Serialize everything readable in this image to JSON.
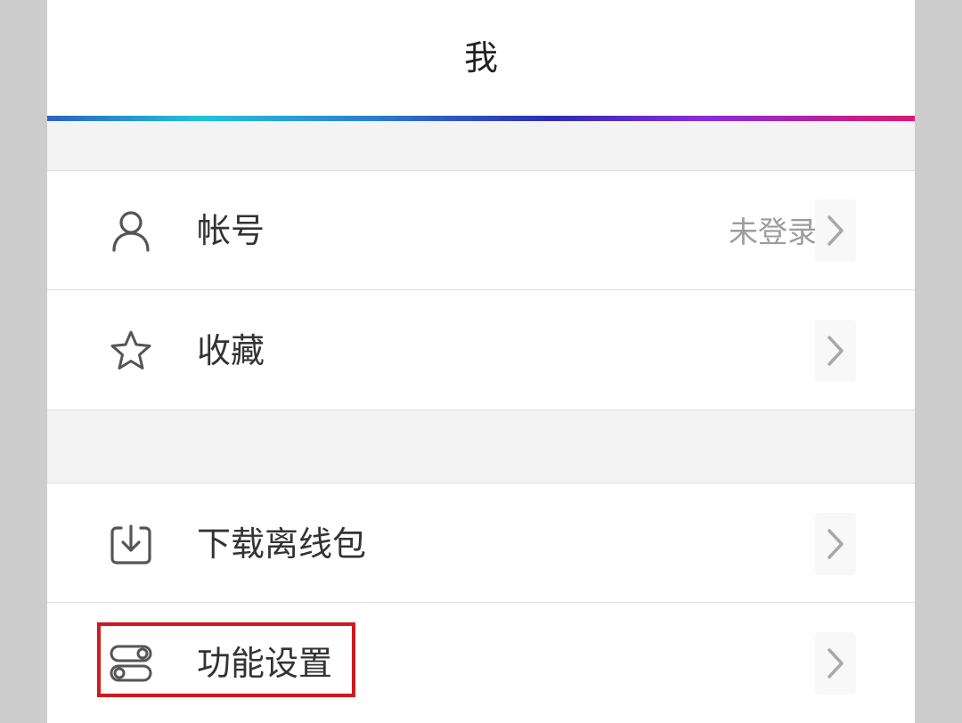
{
  "header": {
    "title": "我"
  },
  "menu": {
    "account": {
      "label": "帐号",
      "value": "未登录",
      "icon": "user-icon"
    },
    "favorites": {
      "label": "收藏",
      "icon": "star-icon"
    },
    "offline": {
      "label": "下载离线包",
      "icon": "download-icon"
    },
    "settings": {
      "label": "功能设置",
      "icon": "toggles-icon"
    }
  },
  "colors": {
    "header_gradient": [
      "#2c61c8",
      "#1fc5d9",
      "#2b2bb8",
      "#8a2be2",
      "#e0166e"
    ],
    "highlight": "#d0191c",
    "background": "#f3f3f3"
  }
}
